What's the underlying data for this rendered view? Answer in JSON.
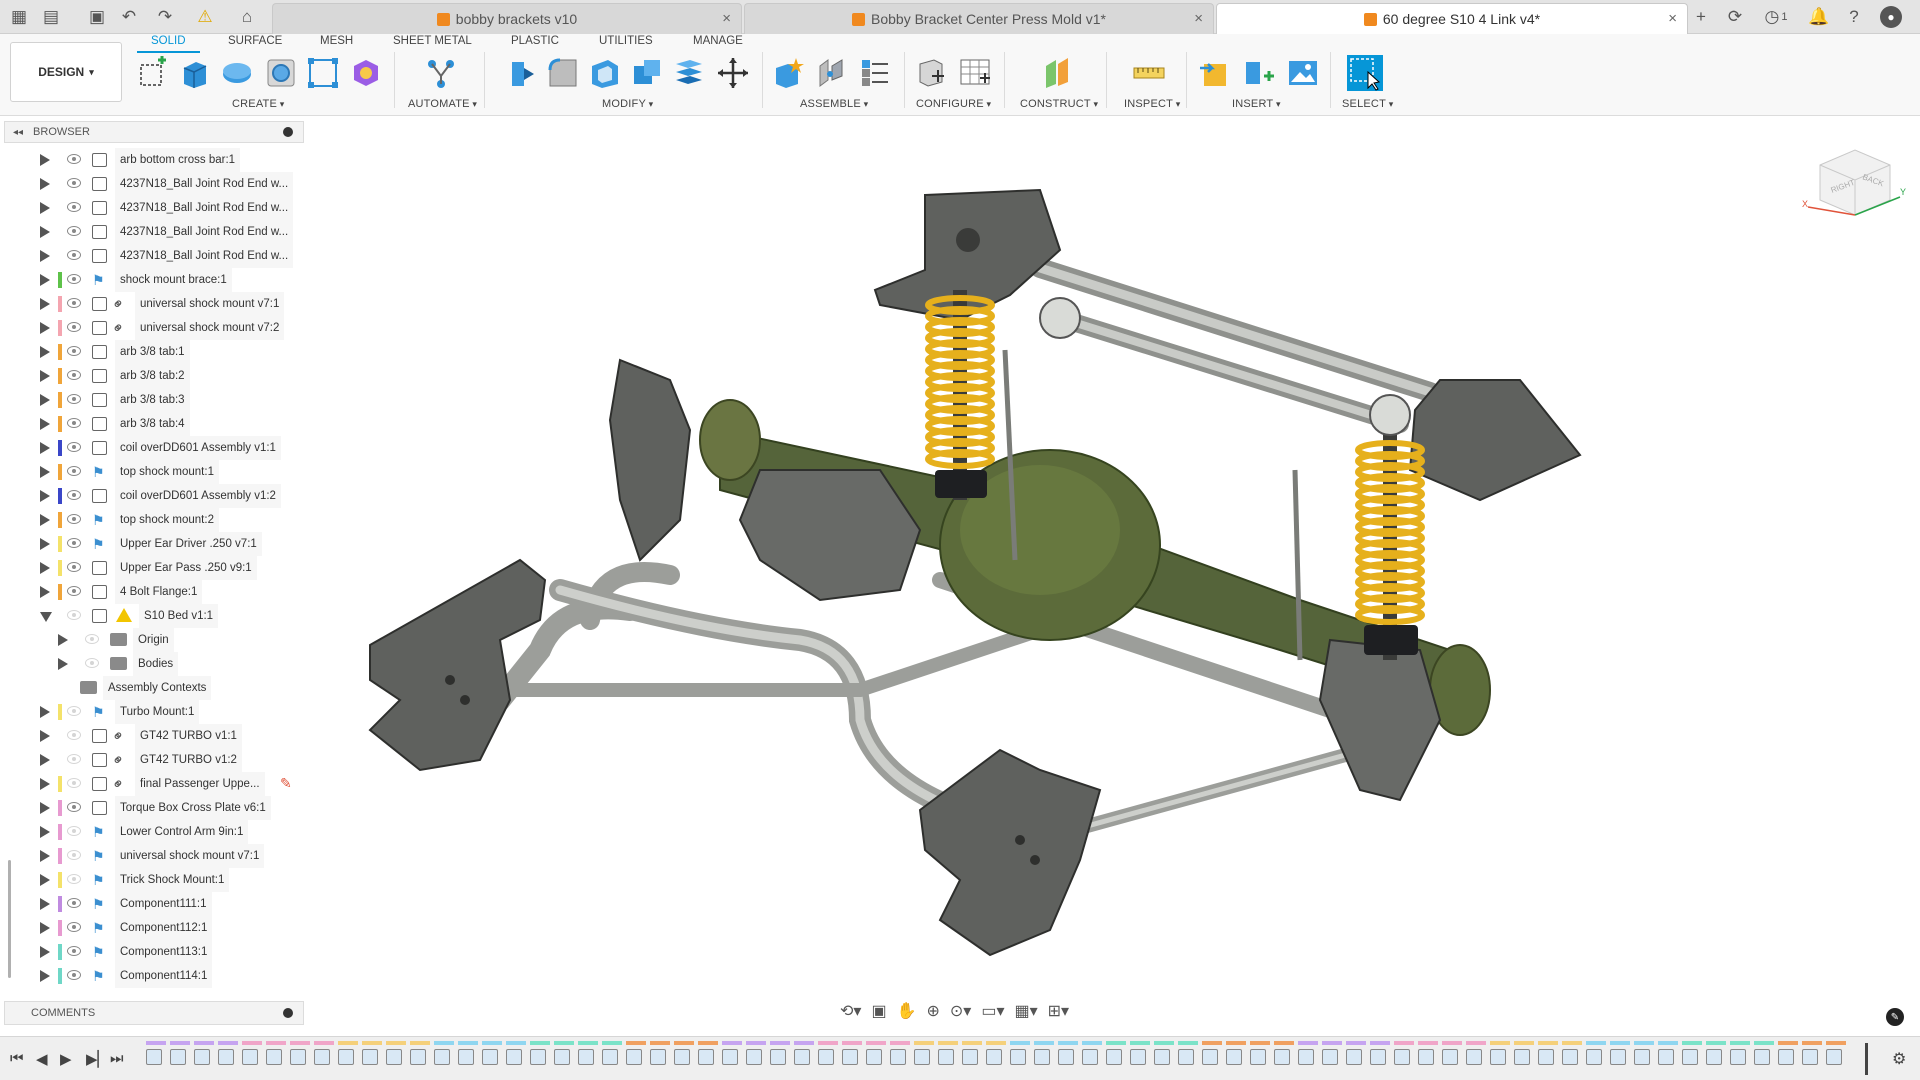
{
  "tabs": [
    {
      "title": "bobby brackets v10",
      "active": false
    },
    {
      "title": "Bobby Bracket Center Press Mold v1*",
      "active": false
    },
    {
      "title": "60 degree S10 4 Link v4*",
      "active": true
    }
  ],
  "header_right": {
    "jobs_count": "1"
  },
  "toolbar": {
    "design_label": "DESIGN",
    "workspace_tabs": [
      "SOLID",
      "SURFACE",
      "MESH",
      "SHEET METAL",
      "PLASTIC",
      "UTILITIES",
      "MANAGE"
    ],
    "groups": [
      "CREATE",
      "AUTOMATE",
      "MODIFY",
      "ASSEMBLE",
      "CONFIGURE",
      "CONSTRUCT",
      "INSPECT",
      "INSERT",
      "SELECT"
    ]
  },
  "browser": {
    "title": "BROWSER",
    "items": [
      {
        "label": "arb bottom cross bar:1",
        "color": "#ffffff",
        "icon": "component",
        "indent": 0,
        "visible": true
      },
      {
        "label": "4237N18_Ball Joint Rod End w...",
        "color": "#ffffff",
        "icon": "component",
        "indent": 0,
        "visible": true
      },
      {
        "label": "4237N18_Ball Joint Rod End w...",
        "color": "#ffffff",
        "icon": "component",
        "indent": 0,
        "visible": true
      },
      {
        "label": "4237N18_Ball Joint Rod End w...",
        "color": "#ffffff",
        "icon": "component",
        "indent": 0,
        "visible": true
      },
      {
        "label": "4237N18_Ball Joint Rod End w...",
        "color": "#ffffff",
        "icon": "component",
        "indent": 0,
        "visible": true
      },
      {
        "label": "shock mount brace:1",
        "color": "#5ec24a",
        "icon": "flag",
        "indent": 0,
        "visible": true
      },
      {
        "label": "universal shock mount v7:1",
        "color": "#f4a5b0",
        "icon": "link",
        "indent": 0,
        "visible": true
      },
      {
        "label": "universal shock mount v7:2",
        "color": "#f4a5b0",
        "icon": "link",
        "indent": 0,
        "visible": true
      },
      {
        "label": "arb 3/8 tab:1",
        "color": "#f0a53a",
        "icon": "component",
        "indent": 0,
        "visible": true
      },
      {
        "label": "arb 3/8 tab:2",
        "color": "#f0a53a",
        "icon": "component",
        "indent": 0,
        "visible": true
      },
      {
        "label": "arb 3/8 tab:3",
        "color": "#f0a53a",
        "icon": "component",
        "indent": 0,
        "visible": true
      },
      {
        "label": "arb 3/8 tab:4",
        "color": "#f0a53a",
        "icon": "component",
        "indent": 0,
        "visible": true
      },
      {
        "label": "coil overDD601 Assembly v1:1",
        "color": "#3a46c8",
        "icon": "component",
        "indent": 0,
        "visible": true
      },
      {
        "label": "top shock mount:1",
        "color": "#f0a53a",
        "icon": "flag",
        "indent": 0,
        "visible": true
      },
      {
        "label": "coil overDD601 Assembly v1:2",
        "color": "#3a46c8",
        "icon": "component",
        "indent": 0,
        "visible": true
      },
      {
        "label": "top shock mount:2",
        "color": "#f0a53a",
        "icon": "flag",
        "indent": 0,
        "visible": true
      },
      {
        "label": "Upper Ear Driver .250 v7:1",
        "color": "#f4e26a",
        "icon": "flag",
        "indent": 0,
        "visible": true
      },
      {
        "label": "Upper Ear Pass .250 v9:1",
        "color": "#f4e26a",
        "icon": "component",
        "indent": 0,
        "visible": true
      },
      {
        "label": "4 Bolt Flange:1",
        "color": "#f0a53a",
        "icon": "component",
        "indent": 0,
        "visible": true
      },
      {
        "label": "S10 Bed v1:1",
        "color": "#ffffff",
        "icon": "warning",
        "indent": 0,
        "visible": false,
        "open": true
      },
      {
        "label": "Origin",
        "color": "#ffffff",
        "icon": "folder",
        "indent": 1,
        "visible": false
      },
      {
        "label": "Bodies",
        "color": "#ffffff",
        "icon": "folder",
        "indent": 1,
        "visible": false
      },
      {
        "label": "Assembly Contexts",
        "color": "#ffffff",
        "icon": "folder",
        "indent": 2,
        "visible": false
      },
      {
        "label": "Turbo Mount:1",
        "color": "#f4e26a",
        "icon": "flag",
        "indent": 0,
        "visible": false
      },
      {
        "label": "GT42 TURBO v1:1",
        "color": "#ffffff",
        "icon": "link",
        "indent": 0,
        "visible": false
      },
      {
        "label": "GT42 TURBO v1:2",
        "color": "#ffffff",
        "icon": "link",
        "indent": 0,
        "visible": false
      },
      {
        "label": "final Passenger Uppe...",
        "color": "#f4e26a",
        "icon": "link",
        "indent": 0,
        "visible": false,
        "edit": true
      },
      {
        "label": "Torque Box Cross Plate v6:1",
        "color": "#e79ad0",
        "icon": "component",
        "indent": 0,
        "visible": true
      },
      {
        "label": "Lower Control Arm 9in:1",
        "color": "#e79ad0",
        "icon": "flag",
        "indent": 0,
        "visible": false
      },
      {
        "label": "universal shock mount v7:1",
        "color": "#e79ad0",
        "icon": "flag",
        "indent": 0,
        "visible": false
      },
      {
        "label": "Trick Shock Mount:1",
        "color": "#f4e26a",
        "icon": "flag",
        "indent": 0,
        "visible": false
      },
      {
        "label": "Component111:1",
        "color": "#c08be0",
        "icon": "flag",
        "indent": 0,
        "visible": true
      },
      {
        "label": "Component112:1",
        "color": "#e79ad0",
        "icon": "flag",
        "indent": 0,
        "visible": true
      },
      {
        "label": "Component113:1",
        "color": "#6fd7c7",
        "icon": "flag",
        "indent": 0,
        "visible": true
      },
      {
        "label": "Component114:1",
        "color": "#6fd7c7",
        "icon": "flag",
        "indent": 0,
        "visible": true
      }
    ]
  },
  "comments": {
    "title": "COMMENTS"
  },
  "viewcube": {
    "faces": [
      "RIGHT",
      "BACK"
    ],
    "axes": [
      "X",
      "Y"
    ]
  },
  "colors": {
    "accent": "#0696d7",
    "metal": "#6b6d6a",
    "tube": "#b6b8b4",
    "coil": "#e6b01c",
    "cover": "#5c6b3a"
  }
}
